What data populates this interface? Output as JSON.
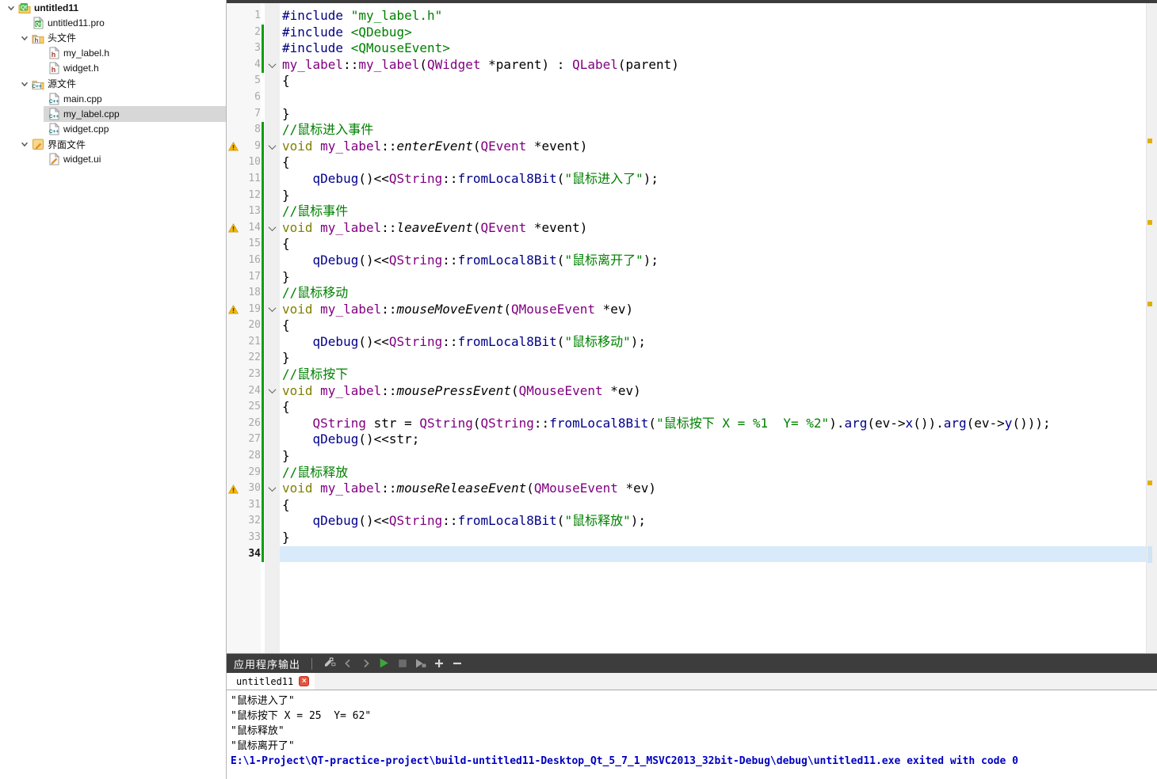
{
  "colors": {
    "keyword": "#808000",
    "type": "#800080",
    "function": "#00008b",
    "preprocessor": "#000080",
    "string_comment": "#008000",
    "warning_mark": "#f6b800",
    "change_bar": "#00a000",
    "current_line_bg": "#d9eafb",
    "exit_line": "#0000c0",
    "panel_header_bg": "#3d3d3d",
    "run_icon_green": "#3da53c",
    "close_tab_red": "#e4553e"
  },
  "sidebar": {
    "items": [
      {
        "label": "untitled11",
        "level": 0,
        "icon": "qt-project",
        "bold": true,
        "expanded": true,
        "selected": false
      },
      {
        "label": "untitled11.pro",
        "level": 1,
        "icon": "qt-pro-file",
        "bold": false,
        "expanded": null,
        "selected": false
      },
      {
        "label": "头文件",
        "level": 1,
        "icon": "header-folder",
        "bold": false,
        "expanded": true,
        "selected": false
      },
      {
        "label": "my_label.h",
        "level": 2,
        "icon": "header-file",
        "bold": false,
        "expanded": null,
        "selected": false
      },
      {
        "label": "widget.h",
        "level": 2,
        "icon": "header-file",
        "bold": false,
        "expanded": null,
        "selected": false
      },
      {
        "label": "源文件",
        "level": 1,
        "icon": "source-folder",
        "bold": false,
        "expanded": true,
        "selected": false
      },
      {
        "label": "main.cpp",
        "level": 2,
        "icon": "cpp-file",
        "bold": false,
        "expanded": null,
        "selected": false
      },
      {
        "label": "my_label.cpp",
        "level": 2,
        "icon": "cpp-file",
        "bold": false,
        "expanded": null,
        "selected": true
      },
      {
        "label": "widget.cpp",
        "level": 2,
        "icon": "cpp-file",
        "bold": false,
        "expanded": null,
        "selected": false
      },
      {
        "label": "界面文件",
        "level": 1,
        "icon": "ui-folder",
        "bold": false,
        "expanded": true,
        "selected": false
      },
      {
        "label": "widget.ui",
        "level": 2,
        "icon": "ui-file",
        "bold": false,
        "expanded": null,
        "selected": false
      }
    ]
  },
  "editor": {
    "lines": [
      {
        "n": 1,
        "warn": false,
        "fold": false,
        "changed": false,
        "current": false,
        "tokens": [
          [
            "pp",
            "#include "
          ],
          [
            "str",
            "\"my_label.h\""
          ]
        ]
      },
      {
        "n": 2,
        "warn": false,
        "fold": false,
        "changed": true,
        "current": false,
        "tokens": [
          [
            "pp",
            "#include "
          ],
          [
            "str",
            "<QDebug>"
          ]
        ]
      },
      {
        "n": 3,
        "warn": false,
        "fold": false,
        "changed": true,
        "current": false,
        "tokens": [
          [
            "pp",
            "#include "
          ],
          [
            "str",
            "<QMouseEvent>"
          ]
        ]
      },
      {
        "n": 4,
        "warn": false,
        "fold": true,
        "changed": true,
        "current": false,
        "tokens": [
          [
            "type",
            "my_label"
          ],
          [
            "pln",
            "::"
          ],
          [
            "type",
            "my_label"
          ],
          [
            "pln",
            "("
          ],
          [
            "type",
            "QWidget"
          ],
          [
            "pln",
            " *parent) : "
          ],
          [
            "type",
            "QLabel"
          ],
          [
            "pln",
            "(parent)"
          ]
        ]
      },
      {
        "n": 5,
        "warn": false,
        "fold": false,
        "changed": false,
        "current": false,
        "tokens": [
          [
            "pln",
            "{"
          ]
        ]
      },
      {
        "n": 6,
        "warn": false,
        "fold": false,
        "changed": false,
        "current": false,
        "tokens": []
      },
      {
        "n": 7,
        "warn": false,
        "fold": false,
        "changed": false,
        "current": false,
        "tokens": [
          [
            "pln",
            "}"
          ]
        ]
      },
      {
        "n": 8,
        "warn": false,
        "fold": false,
        "changed": true,
        "current": false,
        "tokens": [
          [
            "com",
            "//鼠标进入事件"
          ]
        ]
      },
      {
        "n": 9,
        "warn": true,
        "fold": true,
        "changed": true,
        "current": false,
        "tokens": [
          [
            "kw",
            "void"
          ],
          [
            "pln",
            " "
          ],
          [
            "type",
            "my_label"
          ],
          [
            "pln",
            "::"
          ],
          [
            "virt",
            "enterEvent"
          ],
          [
            "pln",
            "("
          ],
          [
            "type",
            "QEvent"
          ],
          [
            "pln",
            " *event)"
          ]
        ]
      },
      {
        "n": 10,
        "warn": false,
        "fold": false,
        "changed": true,
        "current": false,
        "tokens": [
          [
            "pln",
            "{"
          ]
        ]
      },
      {
        "n": 11,
        "warn": false,
        "fold": false,
        "changed": true,
        "current": false,
        "tokens": [
          [
            "pln",
            "    "
          ],
          [
            "fn",
            "qDebug"
          ],
          [
            "pln",
            "()<<"
          ],
          [
            "type",
            "QString"
          ],
          [
            "pln",
            "::"
          ],
          [
            "fn",
            "fromLocal8Bit"
          ],
          [
            "pln",
            "("
          ],
          [
            "str",
            "\"鼠标进入了\""
          ],
          [
            "pln",
            ");"
          ]
        ]
      },
      {
        "n": 12,
        "warn": false,
        "fold": false,
        "changed": true,
        "current": false,
        "tokens": [
          [
            "pln",
            "}"
          ]
        ]
      },
      {
        "n": 13,
        "warn": false,
        "fold": false,
        "changed": true,
        "current": false,
        "tokens": [
          [
            "com",
            "//鼠标事件"
          ]
        ]
      },
      {
        "n": 14,
        "warn": true,
        "fold": true,
        "changed": true,
        "current": false,
        "tokens": [
          [
            "kw",
            "void"
          ],
          [
            "pln",
            " "
          ],
          [
            "type",
            "my_label"
          ],
          [
            "pln",
            "::"
          ],
          [
            "virt",
            "leaveEvent"
          ],
          [
            "pln",
            "("
          ],
          [
            "type",
            "QEvent"
          ],
          [
            "pln",
            " *event)"
          ]
        ]
      },
      {
        "n": 15,
        "warn": false,
        "fold": false,
        "changed": true,
        "current": false,
        "tokens": [
          [
            "pln",
            "{"
          ]
        ]
      },
      {
        "n": 16,
        "warn": false,
        "fold": false,
        "changed": true,
        "current": false,
        "tokens": [
          [
            "pln",
            "    "
          ],
          [
            "fn",
            "qDebug"
          ],
          [
            "pln",
            "()<<"
          ],
          [
            "type",
            "QString"
          ],
          [
            "pln",
            "::"
          ],
          [
            "fn",
            "fromLocal8Bit"
          ],
          [
            "pln",
            "("
          ],
          [
            "str",
            "\"鼠标离开了\""
          ],
          [
            "pln",
            ");"
          ]
        ]
      },
      {
        "n": 17,
        "warn": false,
        "fold": false,
        "changed": true,
        "current": false,
        "tokens": [
          [
            "pln",
            "}"
          ]
        ]
      },
      {
        "n": 18,
        "warn": false,
        "fold": false,
        "changed": true,
        "current": false,
        "tokens": [
          [
            "com",
            "//鼠标移动"
          ]
        ]
      },
      {
        "n": 19,
        "warn": true,
        "fold": true,
        "changed": true,
        "current": false,
        "tokens": [
          [
            "kw",
            "void"
          ],
          [
            "pln",
            " "
          ],
          [
            "type",
            "my_label"
          ],
          [
            "pln",
            "::"
          ],
          [
            "virt",
            "mouseMoveEvent"
          ],
          [
            "pln",
            "("
          ],
          [
            "type",
            "QMouseEvent"
          ],
          [
            "pln",
            " *ev)"
          ]
        ]
      },
      {
        "n": 20,
        "warn": false,
        "fold": false,
        "changed": true,
        "current": false,
        "tokens": [
          [
            "pln",
            "{"
          ]
        ]
      },
      {
        "n": 21,
        "warn": false,
        "fold": false,
        "changed": true,
        "current": false,
        "tokens": [
          [
            "pln",
            "    "
          ],
          [
            "fn",
            "qDebug"
          ],
          [
            "pln",
            "()<<"
          ],
          [
            "type",
            "QString"
          ],
          [
            "pln",
            "::"
          ],
          [
            "fn",
            "fromLocal8Bit"
          ],
          [
            "pln",
            "("
          ],
          [
            "str",
            "\"鼠标移动\""
          ],
          [
            "pln",
            ");"
          ]
        ]
      },
      {
        "n": 22,
        "warn": false,
        "fold": false,
        "changed": true,
        "current": false,
        "tokens": [
          [
            "pln",
            "}"
          ]
        ]
      },
      {
        "n": 23,
        "warn": false,
        "fold": false,
        "changed": true,
        "current": false,
        "tokens": [
          [
            "com",
            "//鼠标按下"
          ]
        ]
      },
      {
        "n": 24,
        "warn": false,
        "fold": true,
        "changed": true,
        "current": false,
        "tokens": [
          [
            "kw",
            "void"
          ],
          [
            "pln",
            " "
          ],
          [
            "type",
            "my_label"
          ],
          [
            "pln",
            "::"
          ],
          [
            "virt",
            "mousePressEvent"
          ],
          [
            "pln",
            "("
          ],
          [
            "type",
            "QMouseEvent"
          ],
          [
            "pln",
            " *ev)"
          ]
        ]
      },
      {
        "n": 25,
        "warn": false,
        "fold": false,
        "changed": true,
        "current": false,
        "tokens": [
          [
            "pln",
            "{"
          ]
        ]
      },
      {
        "n": 26,
        "warn": false,
        "fold": false,
        "changed": true,
        "current": false,
        "tokens": [
          [
            "pln",
            "    "
          ],
          [
            "type",
            "QString"
          ],
          [
            "pln",
            " str = "
          ],
          [
            "type",
            "QString"
          ],
          [
            "pln",
            "("
          ],
          [
            "type",
            "QString"
          ],
          [
            "pln",
            "::"
          ],
          [
            "fn",
            "fromLocal8Bit"
          ],
          [
            "pln",
            "("
          ],
          [
            "str",
            "\"鼠标按下 X = %1  Y= %2\""
          ],
          [
            "pln",
            ")."
          ],
          [
            "fn",
            "arg"
          ],
          [
            "pln",
            "(ev->"
          ],
          [
            "fn",
            "x"
          ],
          [
            "pln",
            "())."
          ],
          [
            "fn",
            "arg"
          ],
          [
            "pln",
            "(ev->"
          ],
          [
            "fn",
            "y"
          ],
          [
            "pln",
            "()));"
          ]
        ]
      },
      {
        "n": 27,
        "warn": false,
        "fold": false,
        "changed": true,
        "current": false,
        "tokens": [
          [
            "pln",
            "    "
          ],
          [
            "fn",
            "qDebug"
          ],
          [
            "pln",
            "()<<str;"
          ]
        ]
      },
      {
        "n": 28,
        "warn": false,
        "fold": false,
        "changed": true,
        "current": false,
        "tokens": [
          [
            "pln",
            "}"
          ]
        ]
      },
      {
        "n": 29,
        "warn": false,
        "fold": false,
        "changed": true,
        "current": false,
        "tokens": [
          [
            "com",
            "//鼠标释放"
          ]
        ]
      },
      {
        "n": 30,
        "warn": true,
        "fold": true,
        "changed": true,
        "current": false,
        "tokens": [
          [
            "kw",
            "void"
          ],
          [
            "pln",
            " "
          ],
          [
            "type",
            "my_label"
          ],
          [
            "pln",
            "::"
          ],
          [
            "virt",
            "mouseReleaseEvent"
          ],
          [
            "pln",
            "("
          ],
          [
            "type",
            "QMouseEvent"
          ],
          [
            "pln",
            " *ev)"
          ]
        ]
      },
      {
        "n": 31,
        "warn": false,
        "fold": false,
        "changed": true,
        "current": false,
        "tokens": [
          [
            "pln",
            "{"
          ]
        ]
      },
      {
        "n": 32,
        "warn": false,
        "fold": false,
        "changed": true,
        "current": false,
        "tokens": [
          [
            "pln",
            "    "
          ],
          [
            "fn",
            "qDebug"
          ],
          [
            "pln",
            "()<<"
          ],
          [
            "type",
            "QString"
          ],
          [
            "pln",
            "::"
          ],
          [
            "fn",
            "fromLocal8Bit"
          ],
          [
            "pln",
            "("
          ],
          [
            "str",
            "\"鼠标释放\""
          ],
          [
            "pln",
            ");"
          ]
        ]
      },
      {
        "n": 33,
        "warn": false,
        "fold": false,
        "changed": true,
        "current": false,
        "tokens": [
          [
            "pln",
            "}"
          ]
        ]
      },
      {
        "n": 34,
        "warn": false,
        "fold": false,
        "changed": true,
        "current": true,
        "tokens": []
      }
    ],
    "warning_lines": [
      9,
      14,
      19,
      30
    ],
    "current_line": 34
  },
  "output": {
    "panel_title": "应用程序输出",
    "tab_label": "untitled11",
    "toolbar_icons": [
      "clear-output-icon",
      "prev-item-icon",
      "next-item-icon",
      "run-icon",
      "stop-icon",
      "run-debug-icon",
      "zoom-in-icon",
      "zoom-out-icon"
    ],
    "lines": [
      {
        "text": "\"鼠标进入了\"",
        "kind": "app"
      },
      {
        "text": "\"鼠标按下 X = 25  Y= 62\"",
        "kind": "app"
      },
      {
        "text": "\"鼠标释放\"",
        "kind": "app"
      },
      {
        "text": "\"鼠标离开了\"",
        "kind": "app"
      },
      {
        "text": "E:\\1-Project\\QT-practice-project\\build-untitled11-Desktop_Qt_5_7_1_MSVC2013_32bit-Debug\\debug\\untitled11.exe exited with code 0",
        "kind": "exit"
      }
    ]
  }
}
